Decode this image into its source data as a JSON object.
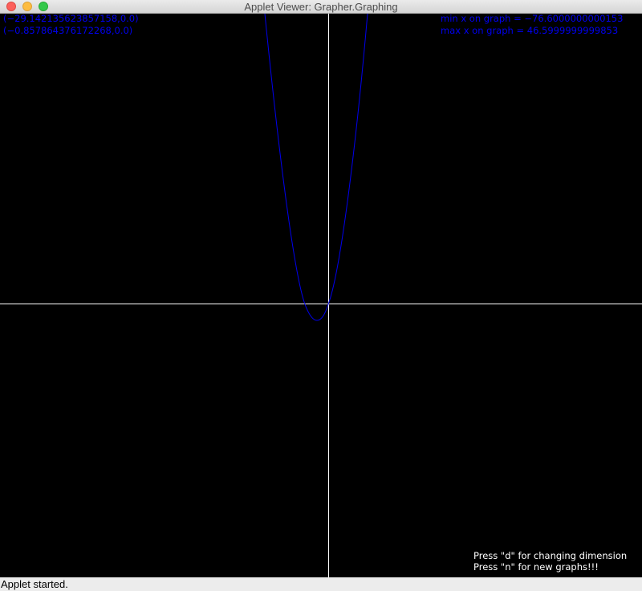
{
  "window": {
    "title": "Applet Viewer: Grapher.Graphing"
  },
  "graph": {
    "background_color": "#000000",
    "axis_color": "#ffffff",
    "curve_color": "#0000ee",
    "root_1": "(−29.142135623857158,0.0)",
    "root_2": "(−0.857864376172268,0.0)",
    "min_x_text": "min x on graph = −76.6000000000153",
    "max_x_text": "max x on graph = 46.5999999999853",
    "hint_dimension": "Press \"d\" for changing dimension",
    "hint_new_graph": "Press \"n\" for new graphs!!!"
  },
  "status": {
    "text": "Applet started."
  }
}
